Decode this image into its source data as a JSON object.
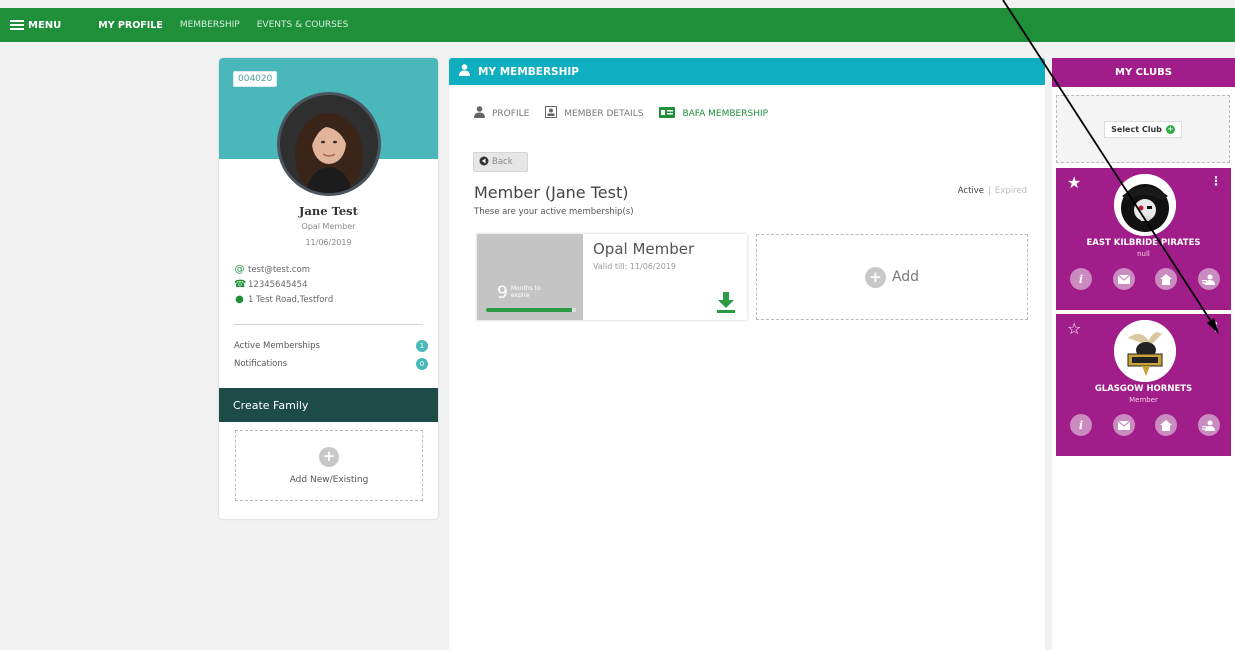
{
  "nav": {
    "menu_label": "MENU",
    "links": [
      "MY PROFILE",
      "MEMBERSHIP",
      "EVENTS & COURSES"
    ]
  },
  "profile": {
    "member_code": "004020",
    "name": "Jane Test",
    "tier": "Opal Member",
    "date": "11/06/2019",
    "email": "test@test.com",
    "phone": "12345645454",
    "address": "1 Test Road,Testford",
    "stats": [
      {
        "label": "Active Memberships",
        "count": "1"
      },
      {
        "label": "Notifications",
        "count": "0"
      }
    ],
    "create_family_label": "Create Family",
    "add_existing_label": "Add New/Existing"
  },
  "membership": {
    "header": "MY MEMBERSHIP",
    "tabs": [
      {
        "label": "PROFILE",
        "icon": "person-icon"
      },
      {
        "label": "MEMBER DETAILS",
        "icon": "id-card-icon"
      },
      {
        "label": "BAFA MEMBERSHIP",
        "icon": "membership-card-icon"
      }
    ],
    "back_label": "Back",
    "title": "Member (Jane Test)",
    "subtitle": "These are your active membership(s)",
    "filter_active": "Active",
    "filter_expired": "Expired",
    "card": {
      "months_value": "9",
      "months_text": "Months to expire",
      "progress_fraction": 0.95,
      "title": "Opal Member",
      "valid": "Valid till: 11/06/2019"
    },
    "add_label": "Add"
  },
  "clubs": {
    "header": "MY CLUBS",
    "select_label": "Select Club",
    "items": [
      {
        "name": "EAST KILBRIDE PIRATES",
        "role": "null",
        "favorite": true
      },
      {
        "name": "GLASGOW HORNETS",
        "role": "Member",
        "favorite": false
      }
    ]
  },
  "colors": {
    "nav_green": "#1f8f3a",
    "teal": "#4ab8ba",
    "cyan_header": "#0faec1",
    "club_purple": "#a01d8a",
    "dark_teal": "#1d4c47"
  }
}
